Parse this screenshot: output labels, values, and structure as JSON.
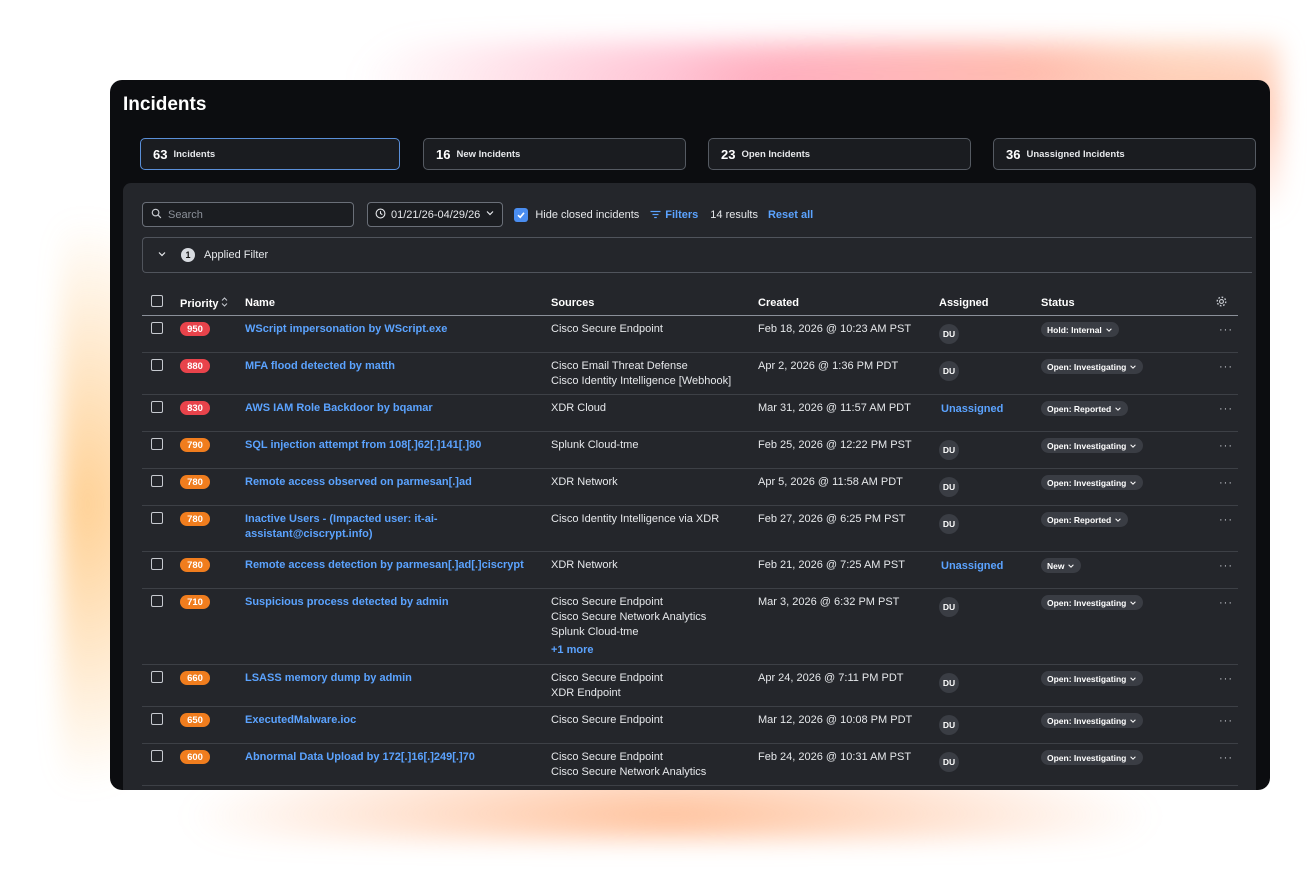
{
  "page": {
    "title": "Incidents"
  },
  "stats": [
    {
      "number": "63",
      "label": "Incidents",
      "active": true
    },
    {
      "number": "16",
      "label": "New Incidents",
      "active": false
    },
    {
      "number": "23",
      "label": "Open Incidents",
      "active": false
    },
    {
      "number": "36",
      "label": "Unassigned Incidents",
      "active": false
    }
  ],
  "toolbar": {
    "search_placeholder": "Search",
    "date_range": "01/21/26-04/29/26",
    "hide_closed_label": "Hide closed incidents",
    "hide_closed_checked": true,
    "filters_label": "Filters",
    "results": "14 results",
    "reset_label": "Reset all"
  },
  "applied_filter": {
    "count": "1",
    "label": "Applied Filter"
  },
  "columns": {
    "priority": "Priority",
    "name": "Name",
    "sources": "Sources",
    "created": "Created",
    "assigned": "Assigned",
    "status": "Status"
  },
  "colors": {
    "accent": "#5ba3ff",
    "priority_high": "#e8434b",
    "priority_medium": "#f07d1e"
  },
  "rows": [
    {
      "priority": "950",
      "name": "WScript impersonation by WScript.exe",
      "sources": [
        "Cisco Secure Endpoint"
      ],
      "more": "",
      "created": "Feb 18, 2026 @ 10:23 AM PST",
      "assigned": "DU",
      "status": "Hold: Internal"
    },
    {
      "priority": "880",
      "name": "MFA flood detected by matth",
      "sources": [
        "Cisco Email Threat Defense",
        "Cisco Identity Intelligence [Webhook]"
      ],
      "more": "",
      "created": "Apr 2, 2026 @ 1:36 PM PDT",
      "assigned": "DU",
      "status": "Open: Investigating"
    },
    {
      "priority": "830",
      "name": "AWS IAM Role Backdoor by bqamar",
      "sources": [
        "XDR Cloud"
      ],
      "more": "",
      "created": "Mar 31, 2026 @ 11:57 AM PDT",
      "assigned": "Unassigned",
      "status": "Open: Reported"
    },
    {
      "priority": "790",
      "name": "SQL injection attempt from 108[.]62[.]141[.]80",
      "sources": [
        "Splunk Cloud-tme"
      ],
      "more": "",
      "created": "Feb 25, 2026 @ 12:22 PM PST",
      "assigned": "DU",
      "status": "Open: Investigating"
    },
    {
      "priority": "780",
      "name": "Remote access observed on parmesan[.]ad",
      "sources": [
        "XDR Network"
      ],
      "more": "",
      "created": "Apr 5, 2026 @ 11:58 AM PDT",
      "assigned": "DU",
      "status": "Open: Investigating"
    },
    {
      "priority": "780",
      "name": "Inactive Users - (Impacted user: it-ai-assistant@ciscrypt.info)",
      "sources": [
        "Cisco Identity Intelligence via XDR"
      ],
      "more": "",
      "created": "Feb 27, 2026 @ 6:25 PM PST",
      "assigned": "DU",
      "status": "Open: Reported"
    },
    {
      "priority": "780",
      "name": "Remote access detection by parmesan[.]ad[.]ciscrypt",
      "sources": [
        "XDR Network"
      ],
      "more": "",
      "created": "Feb 21, 2026 @ 7:25 AM PST",
      "assigned": "Unassigned",
      "status": "New"
    },
    {
      "priority": "710",
      "name": "Suspicious process detected by admin",
      "sources": [
        "Cisco Secure Endpoint",
        "Cisco Secure Network Analytics",
        "Splunk Cloud-tme"
      ],
      "more": "+1 more",
      "created": "Mar 3, 2026 @ 6:32 PM PST",
      "assigned": "DU",
      "status": "Open: Investigating"
    },
    {
      "priority": "660",
      "name": "LSASS memory dump by admin",
      "sources": [
        "Cisco Secure Endpoint",
        "XDR Endpoint"
      ],
      "more": "",
      "created": "Apr 24, 2026 @ 7:11 PM PDT",
      "assigned": "DU",
      "status": "Open: Investigating"
    },
    {
      "priority": "650",
      "name": "ExecutedMalware.ioc",
      "sources": [
        "Cisco Secure Endpoint"
      ],
      "more": "",
      "created": "Mar 12, 2026 @ 10:08 PM PDT",
      "assigned": "DU",
      "status": "Open: Investigating"
    },
    {
      "priority": "600",
      "name": "Abnormal Data Upload by 172[.]16[.]249[.]70",
      "sources": [
        "Cisco Secure Endpoint",
        "Cisco Secure Network Analytics"
      ],
      "more": "",
      "created": "Feb 24, 2026 @ 10:31 AM PST",
      "assigned": "DU",
      "status": "Open: Investigating"
    }
  ]
}
